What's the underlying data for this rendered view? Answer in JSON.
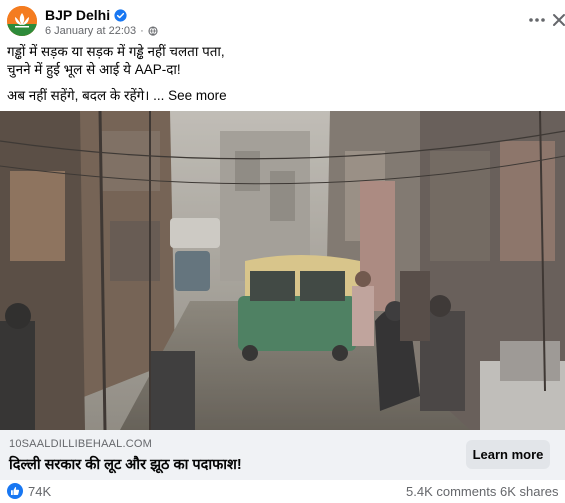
{
  "post": {
    "author": "BJP Delhi",
    "timestamp": "6 January at 22:03",
    "separator": "·",
    "text_line1": "गड्ढों में सड़क या सड़क में गड्ढे नहीं चलता पता,",
    "text_line2": "चुनने में हुई भूल से आई ये AAP-दा!",
    "text_line3": "अब नहीं सहेंगे, बदल के रहेंगे। ...",
    "see_more": "See more"
  },
  "link_preview": {
    "domain": "10SAALDILLIBEHAAL.COM",
    "headline": "दिल्ली सरकार की लूट और झूठ का पदाफाश!",
    "cta": "Learn more"
  },
  "stats": {
    "likes": "74K",
    "comments": "5.4K comments",
    "shares": "6K shares"
  },
  "icons": {
    "verified": "verified-badge-icon",
    "privacy": "globe-icon",
    "more": "more-options-icon",
    "close": "close-icon",
    "like": "like-reaction-icon"
  },
  "colors": {
    "brand_orange": "#f47c20",
    "verified_blue": "#1877f2",
    "like_blue": "#1877f2",
    "link_bg": "#f0f2f5",
    "button_bg": "#e2e5e9"
  }
}
